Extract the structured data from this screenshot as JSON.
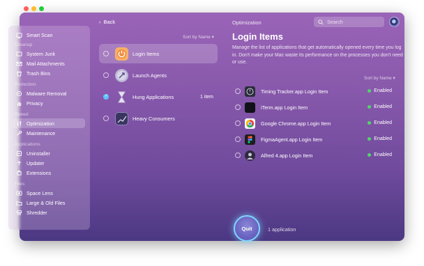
{
  "sidebar": {
    "top_item": "Smart Scan",
    "sections": [
      {
        "title": "Cleanup",
        "items": [
          "System Junk",
          "Mail Attachments",
          "Trash Bins"
        ]
      },
      {
        "title": "Protection",
        "items": [
          "Malware Removal",
          "Privacy"
        ]
      },
      {
        "title": "Speed",
        "items": [
          "Optimization",
          "Maintenance"
        ]
      },
      {
        "title": "Applications",
        "items": [
          "Uninstaller",
          "Updater",
          "Extensions"
        ]
      },
      {
        "title": "Files",
        "items": [
          "Space Lens",
          "Large & Old Files",
          "Shredder"
        ]
      }
    ],
    "active": "Optimization"
  },
  "toolbar": {
    "back_label": "Back",
    "title": "Optimization",
    "search_placeholder": "Search"
  },
  "middle": {
    "sort_label": "Sort by Name ▾",
    "items": [
      {
        "label": "Login Items",
        "count": "",
        "checked": false
      },
      {
        "label": "Launch Agents",
        "count": "",
        "checked": false
      },
      {
        "label": "Hung Applications",
        "count": "1 item",
        "checked": true
      },
      {
        "label": "Heavy Consumers",
        "count": "",
        "checked": false
      }
    ]
  },
  "detail": {
    "title": "Login Items",
    "description": "Manage the list of applications that get automatically opened every time you log in. Don't make your Mac waste its performance on the processes you don't need or use.",
    "sort_label": "Sort by Name ▾",
    "apps": [
      {
        "name": "Timing Tracker.app Login Item",
        "status": "Enabled"
      },
      {
        "name": "iTerm.app Login Item",
        "status": "Enabled"
      },
      {
        "name": "Google Chrome.app Login Item",
        "status": "Enabled"
      },
      {
        "name": "FigmaAgent.app Login Item",
        "status": "Enabled"
      },
      {
        "name": "Alfred 4.app Login Item",
        "status": "Enabled"
      }
    ]
  },
  "footer": {
    "quit_label": "Quit",
    "info": "1 application"
  },
  "colors": {
    "enabled_dot": "#52d66b",
    "accent": "#5fc3ff",
    "quit_ring": "#7fd6ff"
  }
}
